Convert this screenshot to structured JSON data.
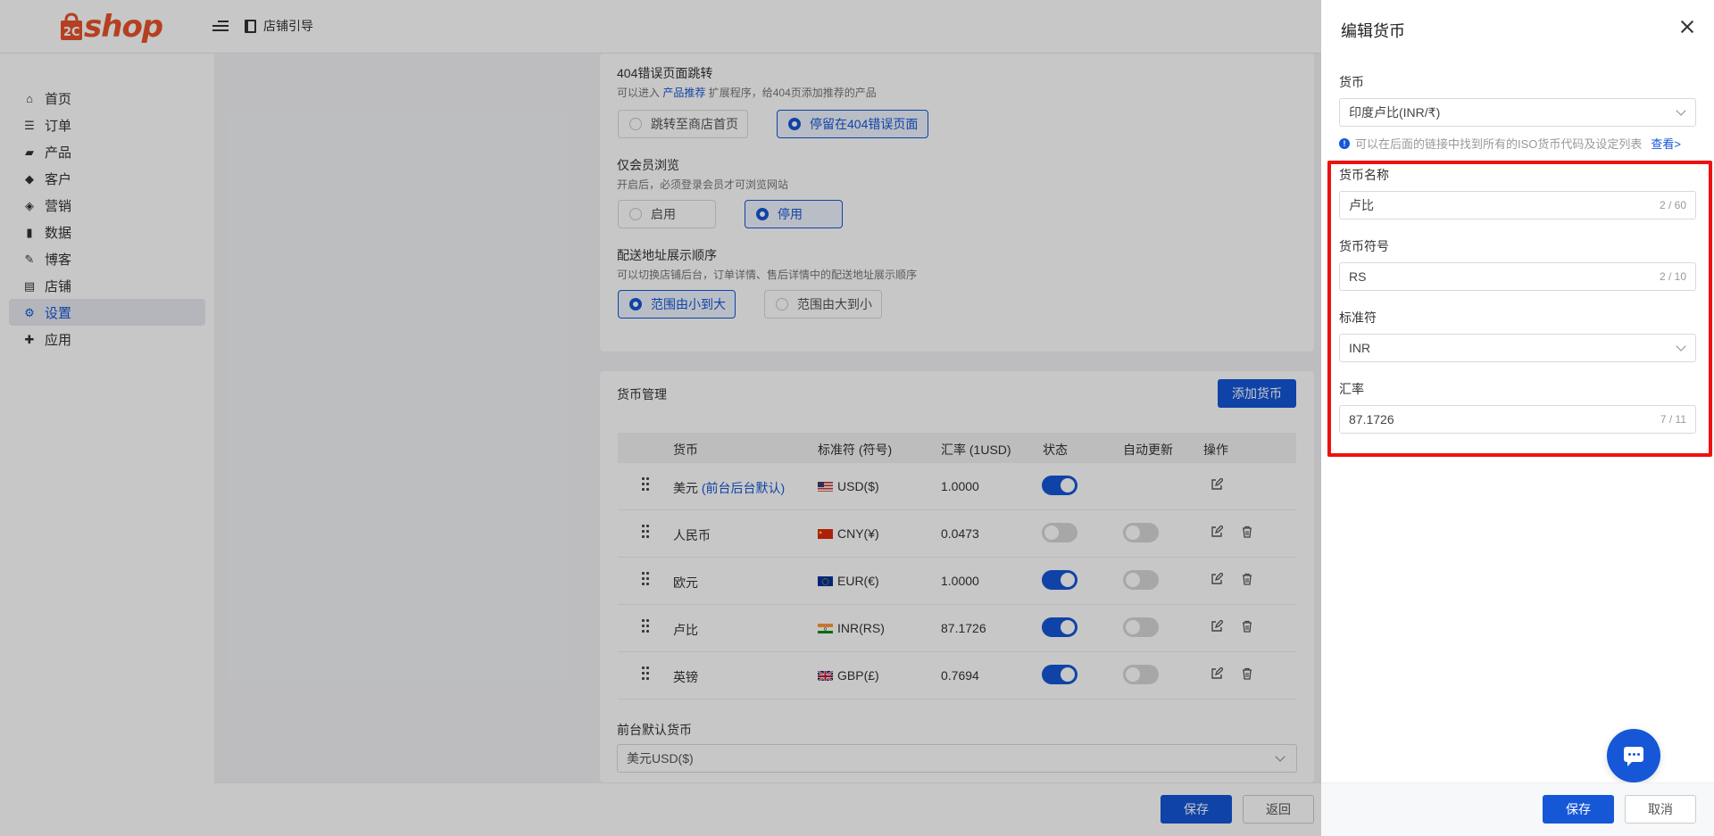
{
  "header": {
    "logo_text": "shop",
    "breadcrumb": "店铺引导"
  },
  "sidebar": {
    "items": [
      {
        "label": "首页",
        "icon": "home-icon"
      },
      {
        "label": "订单",
        "icon": "order-icon"
      },
      {
        "label": "产品",
        "icon": "product-icon"
      },
      {
        "label": "客户",
        "icon": "customer-icon"
      },
      {
        "label": "营销",
        "icon": "tag-icon"
      },
      {
        "label": "数据",
        "icon": "chart-icon"
      },
      {
        "label": "博客",
        "icon": "blog-icon"
      },
      {
        "label": "店铺",
        "icon": "store-icon"
      },
      {
        "label": "设置",
        "icon": "gear-icon",
        "active": true
      },
      {
        "label": "应用",
        "icon": "puzzle-icon"
      }
    ]
  },
  "settings": {
    "not_found": {
      "title": "404错误页面跳转",
      "desc_prefix": "可以进入",
      "desc_link": "产品推荐",
      "desc_suffix": "扩展程序，给404页添加推荐的产品",
      "options": [
        "跳转至商店首页",
        "停留在404错误页面"
      ],
      "selected": "停留在404错误页面"
    },
    "member_only": {
      "title": "仅会员浏览",
      "desc": "开启后，必须登录会员才可浏览网站",
      "options": [
        "启用",
        "停用"
      ],
      "selected": "停用"
    },
    "address_order": {
      "title": "配送地址展示顺序",
      "desc": "可以切换店铺后台，订单详情、售后详情中的配送地址展示顺序",
      "options": [
        "范围由小到大",
        "范围由大到小"
      ],
      "selected": "范围由小到大"
    }
  },
  "currency_mgmt": {
    "title": "货币管理",
    "add_button": "添加货币",
    "columns": [
      "货币",
      "标准符 (符号)",
      "汇率 (1USD)",
      "状态",
      "自动更新",
      "操作"
    ],
    "rows": [
      {
        "name": "美元",
        "tag": "(前台后台默认)",
        "code": "USD($)",
        "flag": "us",
        "rate": "1.0000",
        "status": true,
        "auto": null,
        "deletable": false
      },
      {
        "name": "人民币",
        "tag": "",
        "code": "CNY(¥)",
        "flag": "cn",
        "rate": "0.0473",
        "status": false,
        "auto": false,
        "deletable": true
      },
      {
        "name": "欧元",
        "tag": "",
        "code": "EUR(€)",
        "flag": "eu",
        "rate": "1.0000",
        "status": true,
        "auto": false,
        "deletable": true
      },
      {
        "name": "卢比",
        "tag": "",
        "code": "INR(RS)",
        "flag": "in",
        "rate": "87.1726",
        "status": true,
        "auto": false,
        "deletable": true
      },
      {
        "name": "英镑",
        "tag": "",
        "code": "GBP(£)",
        "flag": "gb",
        "rate": "0.7694",
        "status": true,
        "auto": false,
        "deletable": true
      }
    ],
    "default_label": "前台默认货币",
    "default_value": "美元USD($)"
  },
  "page_footer": {
    "save": "保存",
    "back": "返回"
  },
  "drawer": {
    "title": "编辑货币",
    "currency_label": "货币",
    "currency_value": "印度卢比(INR/₹)",
    "info_text": "可以在后面的链接中找到所有的ISO货币代码及设定列表",
    "info_link": "查看>",
    "name_label": "货币名称",
    "name_value": "卢比",
    "name_count": "2 / 60",
    "symbol_label": "货币符号",
    "symbol_value": "RS",
    "symbol_count": "2 / 10",
    "code_label": "标准符",
    "code_value": "INR",
    "rate_label": "汇率",
    "rate_value": "87.1726",
    "rate_count": "7 / 11",
    "save": "保存",
    "cancel": "取消",
    "highlight_color": "#e11111",
    "accent_color": "#1557d6"
  }
}
